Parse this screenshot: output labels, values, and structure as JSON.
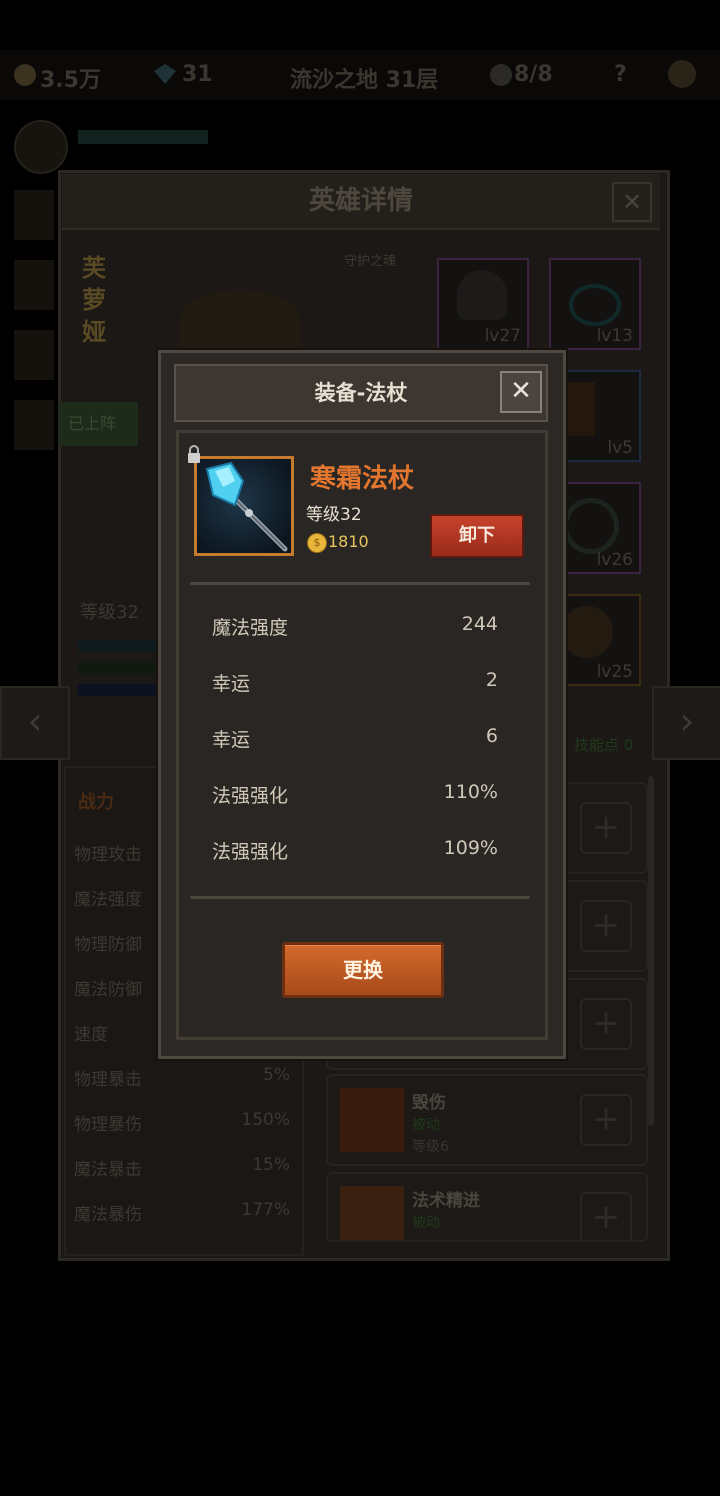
{
  "top_bar": {
    "gold": "3.5万",
    "gems": "31",
    "location": "流沙之地 31层",
    "team": "8/8",
    "help": "?"
  },
  "hero_panel": {
    "title": "英雄详情",
    "close": "✕",
    "hero_name": "芙萝娅",
    "guardian_label": "守护之魂",
    "deployed_label": "已上阵",
    "hero_level": "等级32",
    "skill_points": "技能点 0",
    "equipment_slots": [
      {
        "level": "lv27"
      },
      {
        "level": "lv13"
      },
      {
        "level": "lv5"
      },
      {
        "level": "lv26"
      },
      {
        "level": "lv25"
      }
    ],
    "stats_header": "战力",
    "stats": [
      {
        "label": "物理攻击",
        "value": ""
      },
      {
        "label": "魔法强度",
        "value": ""
      },
      {
        "label": "物理防御",
        "value": ""
      },
      {
        "label": "魔法防御",
        "value": ""
      },
      {
        "label": "速度",
        "value": ""
      },
      {
        "label": "物理暴击",
        "value": "5%"
      },
      {
        "label": "物理暴伤",
        "value": "150%"
      },
      {
        "label": "魔法暴击",
        "value": "15%"
      },
      {
        "label": "魔法暴伤",
        "value": "177%"
      }
    ],
    "skills": [
      {
        "name": "毁伤",
        "type": "被动",
        "level": "等级6"
      },
      {
        "name": "法术精进",
        "type": "被动",
        "level": ""
      }
    ]
  },
  "modal": {
    "title": "装备-法杖",
    "close": "✕",
    "item_name": "寒霜法杖",
    "item_level": "等级32",
    "price": "1810",
    "coin_symbol": "$",
    "unequip_label": "卸下",
    "stats": [
      {
        "label": "魔法强度",
        "value": "244"
      },
      {
        "label": "幸运",
        "value": "2"
      },
      {
        "label": "幸运",
        "value": "6"
      },
      {
        "label": "法强强化",
        "value": "110%"
      },
      {
        "label": "法强强化",
        "value": "109%"
      }
    ],
    "replace_label": "更换"
  }
}
